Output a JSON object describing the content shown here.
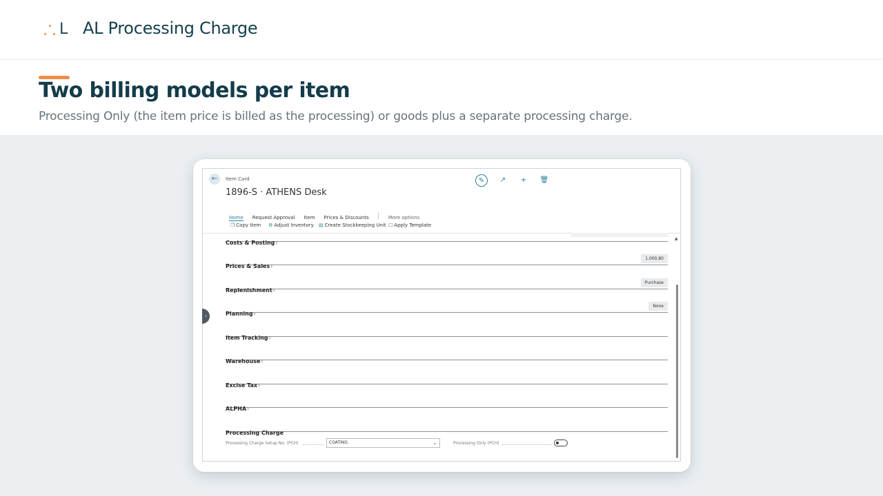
{
  "header": {
    "logo_text": "L",
    "title": "AL Processing Charge"
  },
  "hero": {
    "title": "Two billing models per item",
    "subtitle": "Processing Only (the item price is billed as the processing) or goods plus a separate processing charge."
  },
  "colors": {
    "accent": "#ee8c4c",
    "primary": "#143c4a",
    "link": "#2b7d99"
  },
  "item_card": {
    "breadcrumb": "Item Card",
    "title": "1896-S · ATHENS Desk",
    "actions": [
      "edit-icon",
      "share-icon",
      "new-icon",
      "delete-icon"
    ],
    "tabs": [
      "Home",
      "Request Approval",
      "Item",
      "Prices & Discounts"
    ],
    "more_options": "More options",
    "toolbar": [
      "Copy Item",
      "Adjust Inventory",
      "Create Stockkeeping Unit",
      "Apply Template"
    ],
    "sections": [
      {
        "name": "Costs & Posting",
        "value": ""
      },
      {
        "name": "Prices & Sales",
        "value": "1.000,80"
      },
      {
        "name": "Replenishment",
        "value": "Purchase"
      },
      {
        "name": "Planning",
        "value": "None"
      },
      {
        "name": "Item Tracking",
        "value": ""
      },
      {
        "name": "Warehouse",
        "value": ""
      },
      {
        "name": "Excise Tax",
        "value": ""
      },
      {
        "name": "ALPHA",
        "value": ""
      },
      {
        "name": "Processing Charge",
        "value": ""
      }
    ],
    "fields": {
      "setup_label": "Processing Charge Setup No. (PCH)",
      "setup_value": "COATING",
      "only_label": "Processing Only (PCH)",
      "only_value": "off"
    }
  }
}
